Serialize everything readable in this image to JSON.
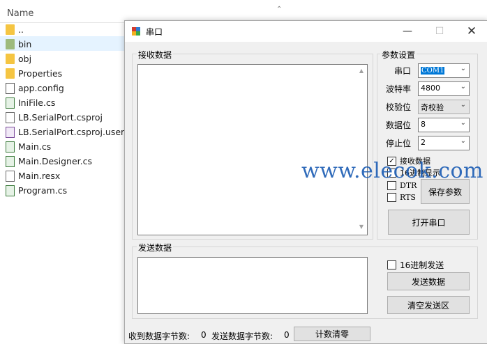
{
  "explorer": {
    "column_name": "Name",
    "files": [
      {
        "name": "..",
        "icon": "folder-icon"
      },
      {
        "name": "bin",
        "icon": "folder-icon"
      },
      {
        "name": "obj",
        "icon": "folder-icon"
      },
      {
        "name": "Properties",
        "icon": "folder-icon"
      },
      {
        "name": "app.config",
        "icon": "config-file-icon"
      },
      {
        "name": "IniFile.cs",
        "icon": "cs-file-icon"
      },
      {
        "name": "LB.SerialPort.csproj",
        "icon": "csproj-file-icon"
      },
      {
        "name": "LB.SerialPort.csproj.user",
        "icon": "user-file-icon"
      },
      {
        "name": "Main.cs",
        "icon": "cs-file-icon"
      },
      {
        "name": "Main.Designer.cs",
        "icon": "cs-file-icon"
      },
      {
        "name": "Main.resx",
        "icon": "resx-file-icon"
      },
      {
        "name": "Program.cs",
        "icon": "cs-file-icon"
      }
    ]
  },
  "window": {
    "title": "串口",
    "receive_group": "接收数据",
    "send_group": "发送数据",
    "params": {
      "group": "参数设置",
      "port_label": "串口",
      "port_value": "COM1",
      "baud_label": "波特率",
      "baud_value": "4800",
      "parity_label": "校验位",
      "parity_value": "奇校验",
      "databits_label": "数据位",
      "databits_value": "8",
      "stopbits_label": "停止位",
      "stopbits_value": "2",
      "recv_data_check": "接收数据",
      "hex_display_check": "16进制显示",
      "dtr_check": "DTR",
      "rts_check": "RTS",
      "save_button": "保存参数",
      "open_button": "打开串口"
    },
    "send": {
      "hex_send_check": "16进制发送",
      "send_button": "发送数据",
      "clear_button": "清空发送区"
    },
    "status": {
      "recv_bytes_label": "收到数据字节数:",
      "recv_bytes_value": "0",
      "send_bytes_label": "发送数据字节数:",
      "send_bytes_value": "0",
      "reset_button": "计数清零"
    }
  },
  "watermark": "www.elecok.com",
  "colors": {
    "accent": "#0078d7",
    "watermark": "#1f5fb5",
    "highlight": "#e5f3ff"
  }
}
